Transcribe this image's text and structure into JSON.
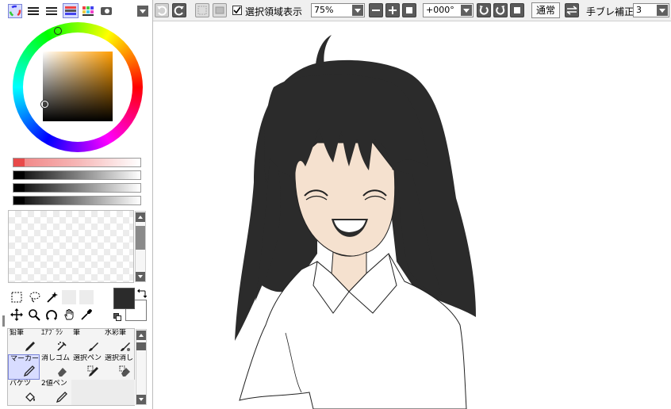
{
  "toolbar": {
    "selection_display_label": "選択領域表示",
    "selection_display_checked": true,
    "zoom_value": "75%",
    "rotation_value": "+000°",
    "blend_mode_label": "通常",
    "stabilizer_label": "手ブレ補正",
    "stabilizer_value": "3"
  },
  "colors": {
    "foreground": "#2b2b2b",
    "background": "#ffffff",
    "hair": "#2b2b2b",
    "skin": "#f5e1cf"
  },
  "tools": [
    {
      "label": "鉛筆",
      "icon": "pencil-icon",
      "selected": false
    },
    {
      "label": "ｴｱﾌﾞﾗｼ",
      "icon": "airbrush-icon",
      "selected": false
    },
    {
      "label": "筆",
      "icon": "brush-icon",
      "selected": false
    },
    {
      "label": "水彩筆",
      "icon": "watercolor-icon",
      "selected": false
    },
    {
      "label": "マーカー",
      "icon": "marker-icon",
      "selected": true
    },
    {
      "label": "消しゴム",
      "icon": "eraser-icon",
      "selected": false
    },
    {
      "label": "選択ペン",
      "icon": "selection-pen-icon",
      "selected": false
    },
    {
      "label": "選択消し",
      "icon": "selection-eraser-icon",
      "selected": false
    },
    {
      "label": "バケツ",
      "icon": "bucket-icon",
      "selected": false
    },
    {
      "label": "2値ペン",
      "icon": "binary-pen-icon",
      "selected": false
    }
  ]
}
